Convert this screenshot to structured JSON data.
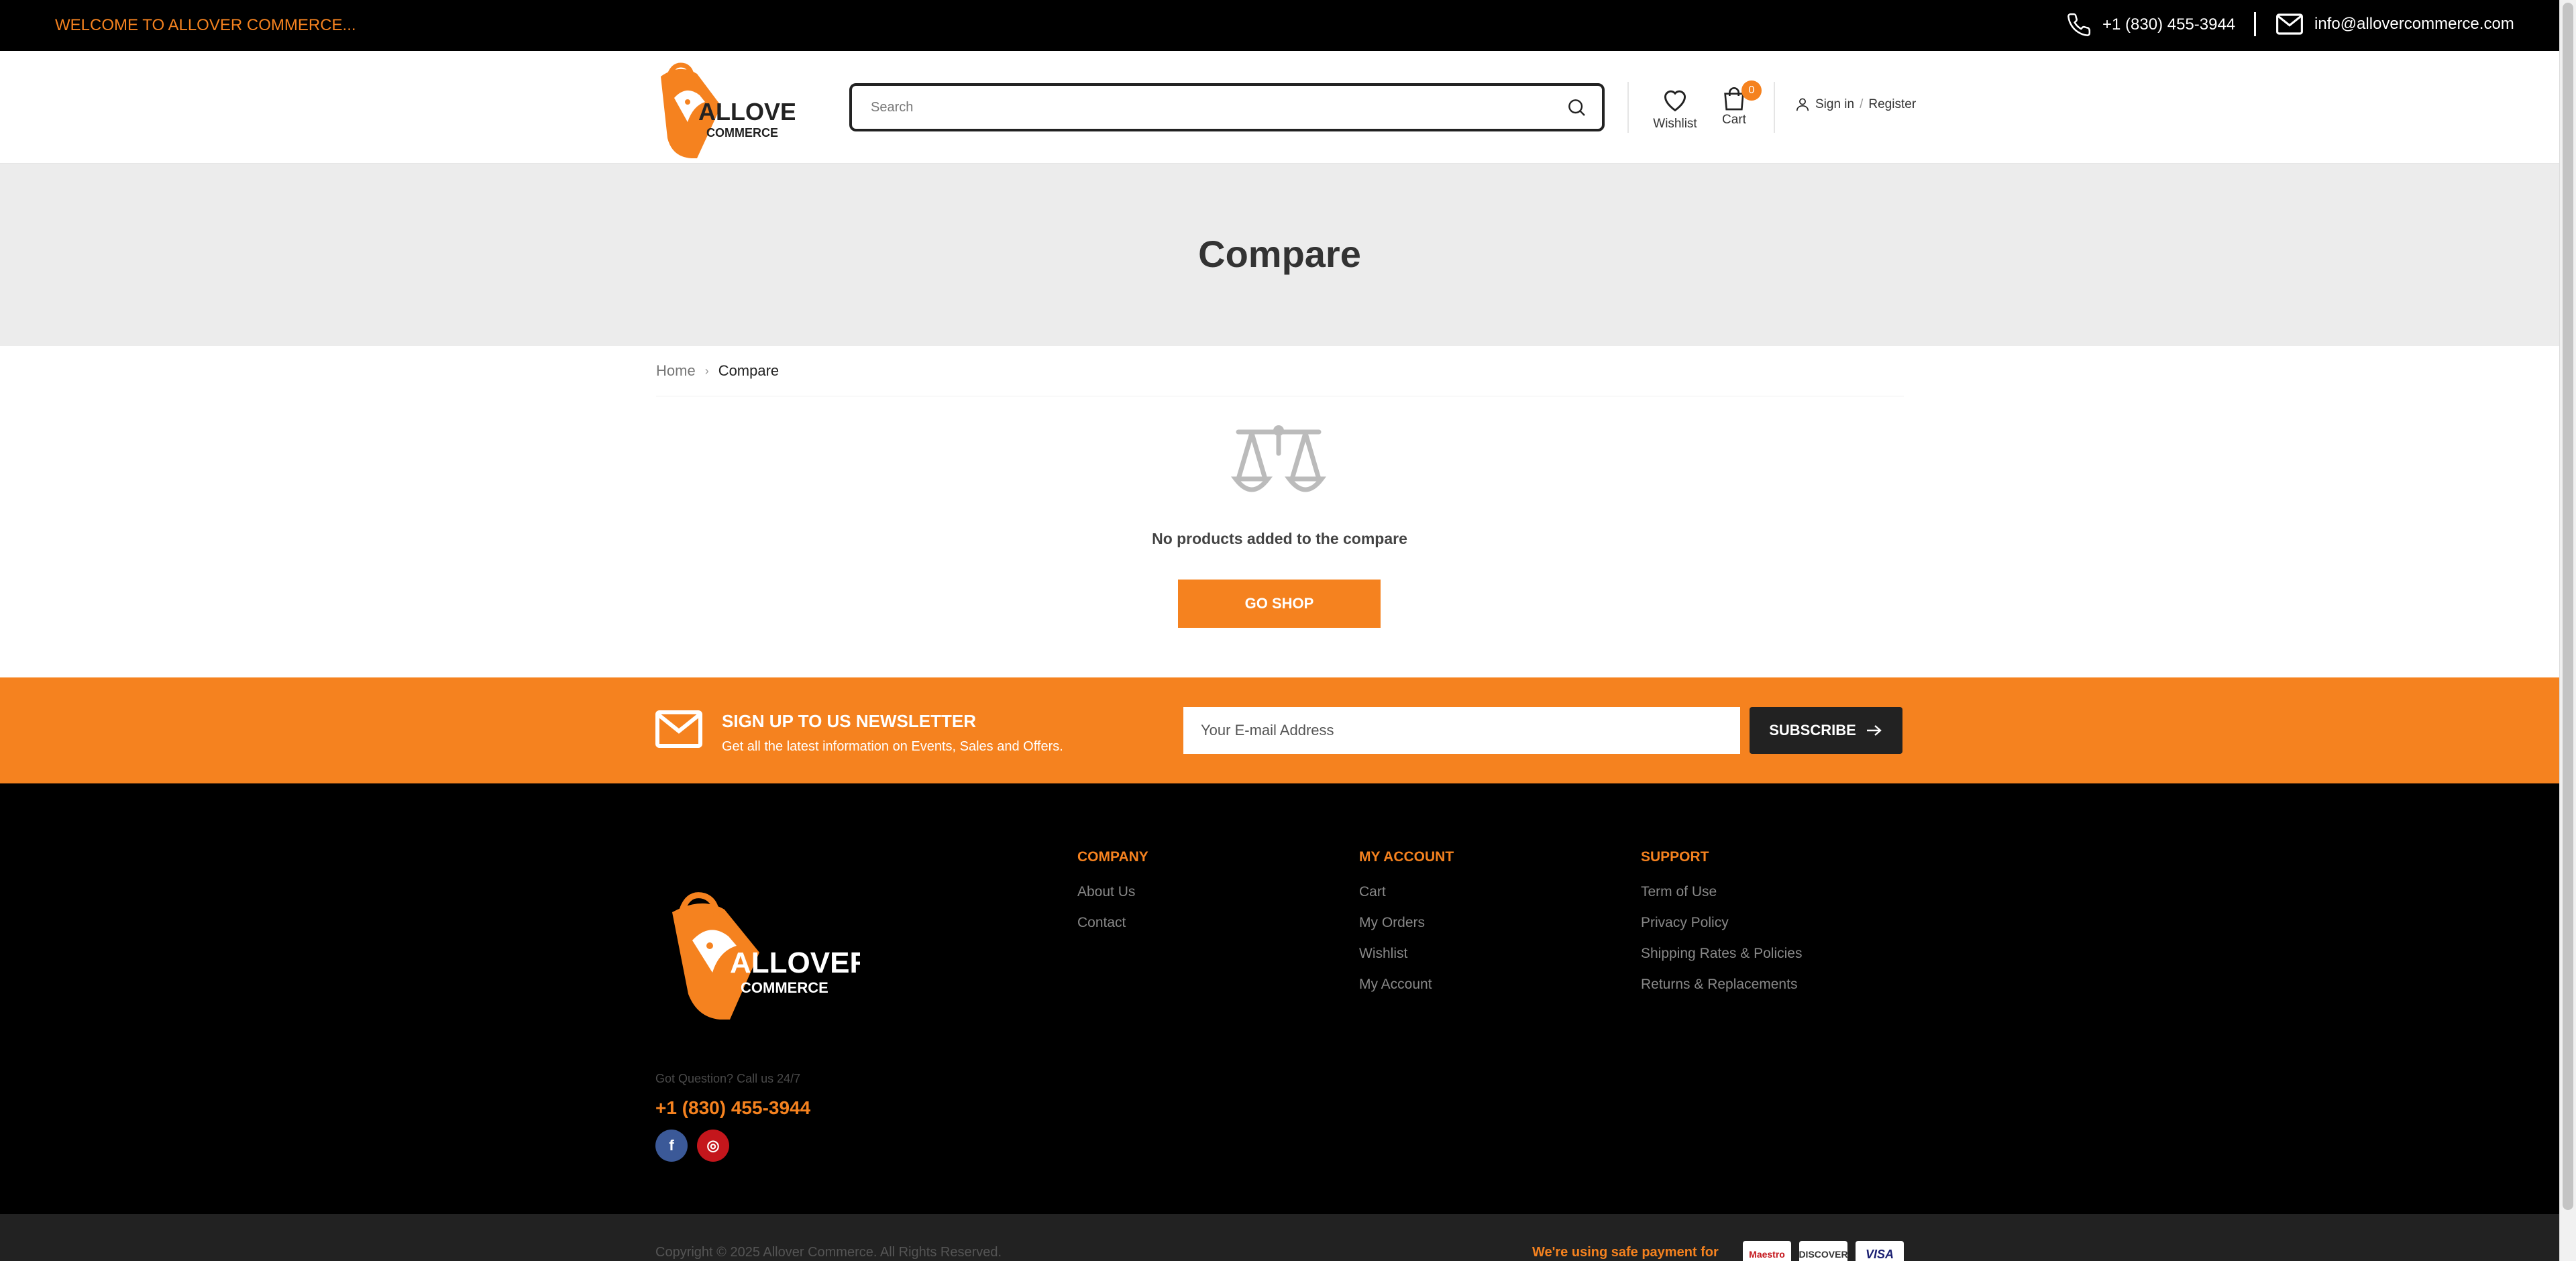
{
  "topbar": {
    "welcome": "WELCOME TO ALLOVER COMMERCE...",
    "phone": "+1 (830) 455-3944",
    "email": "info@allovercommerce.com"
  },
  "brand": {
    "name": "ALLOVER",
    "sub": "COMMERCE",
    "accent": "#f5821f"
  },
  "header": {
    "search_placeholder": "Search",
    "wishlist_label": "Wishlist",
    "cart_label": "Cart",
    "cart_count": "0",
    "signin_label": "Sign in",
    "register_label": "Register",
    "slash": "/"
  },
  "page": {
    "title": "Compare",
    "breadcrumb": [
      {
        "label": "Home"
      },
      {
        "label": "Compare"
      }
    ],
    "empty_message": "No products added to the compare",
    "go_shop_label": "GO SHOP"
  },
  "newsletter": {
    "title": "SIGN UP TO US NEWSLETTER",
    "subtitle": "Get all the latest information on Events, Sales and Offers.",
    "email_placeholder": "Your E-mail Address",
    "subscribe_label": "SUBSCRIBE"
  },
  "footer": {
    "got_question": "Got Question? Call us 24/7",
    "phone": "+1 (830) 455-3944",
    "columns": [
      {
        "title": "COMPANY",
        "links": [
          "About Us",
          "Contact"
        ]
      },
      {
        "title": "MY ACCOUNT",
        "links": [
          "Cart",
          "My Orders",
          "Wishlist",
          "My Account"
        ]
      },
      {
        "title": "SUPPORT",
        "links": [
          "Term of Use",
          "Privacy Policy",
          "Shipping Rates & Policies",
          "Returns & Replacements"
        ]
      }
    ],
    "social": [
      {
        "icon": "facebook-icon",
        "glyph": "f",
        "color": "#3b5998"
      },
      {
        "icon": "instagram-icon",
        "glyph": "◎",
        "color": "#c4161c"
      }
    ],
    "copyright": "Copyright © 2025 Allover Commerce. All Rights Reserved.",
    "safe_payment": "We're using safe payment for",
    "payments": [
      "Maestro",
      "DISCOVER",
      "VISA"
    ]
  }
}
